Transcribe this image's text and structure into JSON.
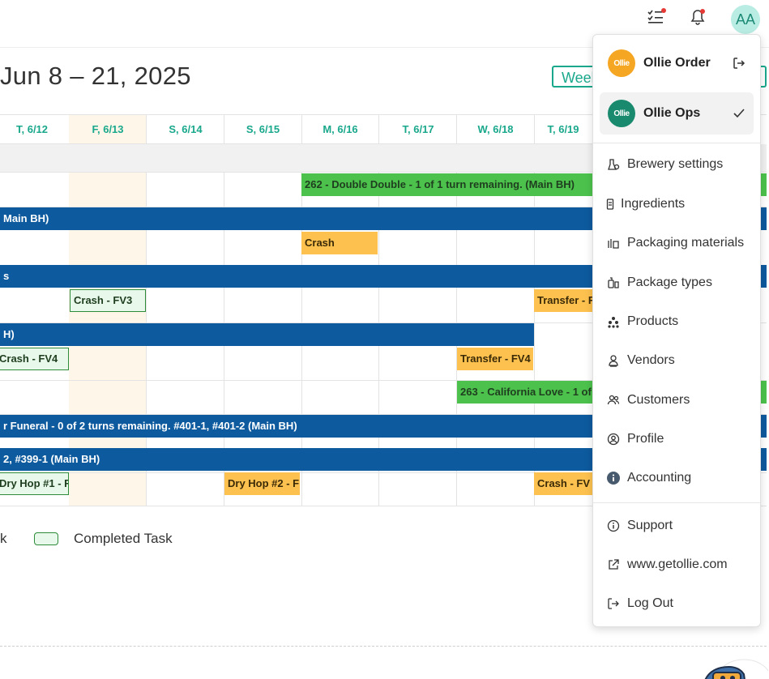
{
  "header": {
    "date_range": "Jun 8 – 21, 2025",
    "view_button_label": "Weel"
  },
  "columns": [
    "T, 6/12",
    "F, 6/13",
    "S, 6/14",
    "S, 6/15",
    "M, 6/16",
    "T, 6/17",
    "W, 6/18",
    "T, 6/19"
  ],
  "bars": {
    "b1": "262 - Double Double - 1 of 1 turn remaining. (Main BH)",
    "b2": "Main BH)",
    "b3": "Crash",
    "b4": "s",
    "b5": "Crash - FV3",
    "b6": "Transfer - F",
    "b7": "H)",
    "b8": "Crash - FV4",
    "b9": "Transfer - FV4",
    "b10": "263 - California Love - 1 of",
    "b11": "r Funeral - 0 of 2 turns remaining. #401-1, #401-2 (Main BH)",
    "b12": "2, #399-1 (Main BH)",
    "b13": "Dry Hop #1 - F",
    "b14": "Dry Hop #2 - F",
    "b15": "Crash - FV"
  },
  "legend": {
    "partial_label": "k",
    "completed_label": "Completed Task"
  },
  "user_avatar": "AA",
  "menu": {
    "accounts": [
      {
        "logo": "Ollie",
        "name": "Ollie Order",
        "color": "#f5a623"
      },
      {
        "logo": "Ollie",
        "name": "Ollie Ops",
        "color": "#1a8a6e"
      }
    ],
    "items": [
      {
        "label": "Brewery settings",
        "icon": "brewery-icon"
      },
      {
        "label": "Ingredients",
        "icon": "ingredients-icon"
      },
      {
        "label": "Packaging materials",
        "icon": "packaging-icon"
      },
      {
        "label": "Package types",
        "icon": "package-types-icon"
      },
      {
        "label": "Products",
        "icon": "products-icon"
      },
      {
        "label": "Vendors",
        "icon": "vendors-icon"
      },
      {
        "label": "Customers",
        "icon": "customers-icon"
      },
      {
        "label": "Profile",
        "icon": "profile-icon"
      },
      {
        "label": "Accounting",
        "icon": "info-icon"
      }
    ],
    "footer": [
      {
        "label": "Support",
        "icon": "info-outline-icon"
      },
      {
        "label": "www.getollie.com",
        "icon": "external-link-icon"
      },
      {
        "label": "Log Out",
        "icon": "logout-icon"
      }
    ]
  },
  "colors": {
    "accent": "#1aa88c",
    "bar_blue": "#0d5a9e",
    "bar_green": "#4cc24c",
    "bar_orange": "#fcc14e",
    "completed_bg": "#e8f8ea"
  }
}
